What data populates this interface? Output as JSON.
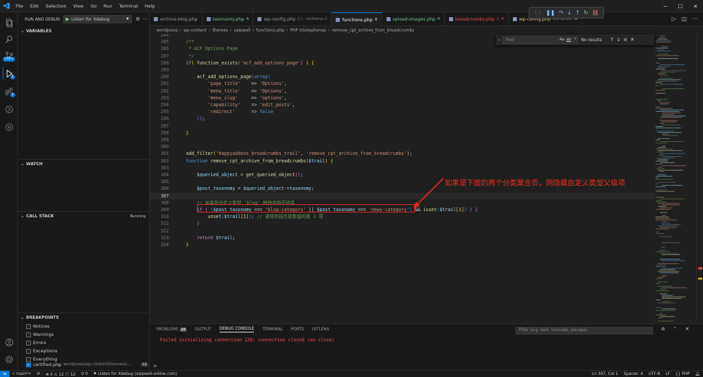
{
  "titlebar": {
    "menu": [
      "File",
      "Edit",
      "Selection",
      "View",
      "Go",
      "Run",
      "Terminal",
      "Help"
    ]
  },
  "debug_toolbar": [
    "pause-icon",
    "restart-icon",
    "step-over-icon",
    "step-into-icon",
    "step-out-icon",
    "restart-icon",
    "disconnect-icon"
  ],
  "sidebar": {
    "header": "RUN AND DEBUG",
    "config": "Listen for Xdebug",
    "sections": {
      "variables": "VARIABLES",
      "watch": "WATCH",
      "call_stack": "CALL STACK",
      "call_stack_status": "Running",
      "breakpoints": "BREAKPOINTS"
    },
    "breakpoints": [
      {
        "label": "Notices",
        "checked": false
      },
      {
        "label": "Warnings",
        "checked": false
      },
      {
        "label": "Errors",
        "checked": false
      },
      {
        "label": "Exceptions",
        "checked": false
      },
      {
        "label": "Everything",
        "checked": false
      }
    ],
    "bp_file": {
      "name": "certified.php",
      "path": "wordpress\\wp-content\\themes\\s...",
      "line": "56"
    }
  },
  "activity_badges": {
    "search": "10K+",
    "debug": "1",
    "extensions": "1"
  },
  "tabs": [
    {
      "label": "archive-blog.php",
      "sub": "",
      "mark": "",
      "color": "#9d9d9d"
    },
    {
      "label": "taxonomy.php",
      "sub": "",
      "mark": "A",
      "color": "#73c991"
    },
    {
      "label": "wp-config.php",
      "sub": "C:\\...\\fs3temp-3",
      "mark": "",
      "color": "#9d9d9d"
    },
    {
      "label": "functions.php",
      "sub": "",
      "mark": "X",
      "color": "#ffffff"
    },
    {
      "label": "upload-images.php",
      "sub": "",
      "mark": "A",
      "color": "#73c991"
    },
    {
      "label": "breadcrumbs.php",
      "sub": "",
      "mark": "1, A",
      "color": "#f14c4c"
    },
    {
      "label": "wp-config.php",
      "sub": "wordpress",
      "mark": "M",
      "color": "#e2c08d"
    }
  ],
  "breadcrumbs": [
    "wordpress",
    "wp-content",
    "themes",
    "saipwell",
    "functions.php",
    "PHP Intelephense",
    "remove_cpt_archive_from_breadcrumbs"
  ],
  "find": {
    "placeholder": "Find",
    "opt_case": "Aa",
    "opt_word": "ab",
    "opt_regex": ".*",
    "result": "No results"
  },
  "code_lines": [
    {
      "n": "284",
      "segs": []
    },
    {
      "n": "285",
      "segs": [
        [
          "c-com",
          "    /**"
        ]
      ]
    },
    {
      "n": "286",
      "segs": [
        [
          "c-com",
          "     * ACF Options Page"
        ]
      ]
    },
    {
      "n": "287",
      "segs": [
        [
          "c-com",
          "     */"
        ]
      ]
    },
    {
      "n": "288",
      "segs": [
        [
          "c-ctl",
          "    if"
        ],
        [
          "c-br1",
          "("
        ],
        [
          "c-pun",
          " "
        ],
        [
          "c-fn",
          "function_exists"
        ],
        [
          "c-br2",
          "("
        ],
        [
          "c-str",
          "'acf_add_options_page'"
        ],
        [
          "c-br2",
          ")"
        ],
        [
          "c-pun",
          " "
        ],
        [
          "c-br1",
          ")"
        ],
        [
          "c-pun",
          " "
        ],
        [
          "c-br1",
          "{"
        ]
      ]
    },
    {
      "n": "289",
      "segs": []
    },
    {
      "n": "290",
      "segs": [
        [
          "c-fn",
          "        acf_add_options_page"
        ],
        [
          "c-br2",
          "("
        ],
        [
          "c-kw",
          "array"
        ],
        [
          "c-br3",
          "("
        ]
      ]
    },
    {
      "n": "291",
      "segs": [
        [
          "c-str",
          "            'page_title'"
        ],
        [
          "c-pun",
          "    => "
        ],
        [
          "c-str",
          "'Options'"
        ],
        [
          "c-pun",
          ","
        ]
      ]
    },
    {
      "n": "292",
      "segs": [
        [
          "c-str",
          "            'menu_title'"
        ],
        [
          "c-pun",
          "    => "
        ],
        [
          "c-str",
          "'Options'"
        ],
        [
          "c-pun",
          ","
        ]
      ]
    },
    {
      "n": "293",
      "segs": [
        [
          "c-str",
          "            'menu_slug'"
        ],
        [
          "c-pun",
          "     => "
        ],
        [
          "c-str",
          "'options'"
        ],
        [
          "c-pun",
          ","
        ]
      ]
    },
    {
      "n": "294",
      "segs": [
        [
          "c-str",
          "            'capability'"
        ],
        [
          "c-pun",
          "    => "
        ],
        [
          "c-str",
          "'edit_posts'"
        ],
        [
          "c-pun",
          ","
        ]
      ]
    },
    {
      "n": "295",
      "segs": [
        [
          "c-str",
          "            'redirect'"
        ],
        [
          "c-pun",
          "      => "
        ],
        [
          "c-kw",
          "false"
        ]
      ]
    },
    {
      "n": "296",
      "segs": [
        [
          "c-br3",
          "        )"
        ],
        [
          "c-br2",
          ")"
        ],
        [
          "c-pun",
          ";"
        ]
      ]
    },
    {
      "n": "297",
      "segs": []
    },
    {
      "n": "298",
      "segs": [
        [
          "c-br1",
          "    }"
        ]
      ]
    },
    {
      "n": "299",
      "segs": []
    },
    {
      "n": "300",
      "segs": []
    },
    {
      "n": "301",
      "segs": [
        [
          "c-fn",
          "    add_filter"
        ],
        [
          "c-br1",
          "("
        ],
        [
          "c-str",
          "'happyaddons_breadcrumbs_trail'"
        ],
        [
          "c-pun",
          ", "
        ],
        [
          "c-str",
          "'remove_cpt_archive_from_breadcrumbs'"
        ],
        [
          "c-br1",
          ")"
        ],
        [
          "c-pun",
          ";"
        ]
      ]
    },
    {
      "n": "302",
      "segs": [
        [
          "c-kw",
          "    function "
        ],
        [
          "c-fn",
          "remove_cpt_archive_from_breadcrumbs"
        ],
        [
          "c-br1",
          "("
        ],
        [
          "c-var",
          "$trail"
        ],
        [
          "c-br1",
          ")"
        ],
        [
          "c-pun",
          " "
        ],
        [
          "c-br1",
          "{"
        ]
      ]
    },
    {
      "n": "303",
      "segs": []
    },
    {
      "n": "304",
      "segs": [
        [
          "c-var",
          "        $queried_object"
        ],
        [
          "c-pun",
          " = "
        ],
        [
          "c-fn",
          "get_queried_object"
        ],
        [
          "c-br2",
          "()"
        ],
        [
          "c-pun",
          ";"
        ]
      ]
    },
    {
      "n": "305",
      "segs": []
    },
    {
      "n": "306",
      "segs": [
        [
          "c-var",
          "        $post_taxonomy"
        ],
        [
          "c-pun",
          " = "
        ],
        [
          "c-var",
          "$queried_object"
        ],
        [
          "c-pun",
          "->"
        ],
        [
          "c-var",
          "taxonomy"
        ],
        [
          "c-pun",
          ";"
        ]
      ]
    },
    {
      "n": "307",
      "segs": [],
      "current": true
    },
    {
      "n": "308",
      "segs": [
        [
          "c-com",
          "        // 如果是自定义类型 'blog' 移除存档页链接"
        ]
      ]
    },
    {
      "n": "309",
      "segs": [
        [
          "c-ctl",
          "        if"
        ],
        [
          "c-pun",
          " "
        ],
        [
          "c-br2",
          "("
        ],
        [
          "c-pun",
          " "
        ],
        [
          "c-br3",
          "("
        ],
        [
          "c-var",
          "$post_taxonomy"
        ],
        [
          "c-pun",
          " === "
        ],
        [
          "c-str",
          "'blog-category'"
        ],
        [
          "c-pun",
          " || "
        ],
        [
          "c-var",
          "$post_taxonomy"
        ],
        [
          "c-pun",
          " === "
        ],
        [
          "c-str",
          "'news-category'"
        ],
        [
          "c-br3",
          ")"
        ],
        [
          "c-pun",
          " && "
        ],
        [
          "c-fn",
          "isset"
        ],
        [
          "c-br3",
          "("
        ],
        [
          "c-var",
          "$trail"
        ],
        [
          "c-br1",
          "["
        ],
        [
          "c-pun",
          "1"
        ],
        [
          "c-br1",
          "]"
        ],
        [
          "c-br3",
          ")"
        ],
        [
          "c-pun",
          " "
        ],
        [
          "c-br2",
          ")"
        ],
        [
          "c-pun",
          " "
        ],
        [
          "c-br2",
          "{"
        ]
      ]
    },
    {
      "n": "310",
      "segs": [
        [
          "c-fn",
          "            unset"
        ],
        [
          "c-br3",
          "("
        ],
        [
          "c-var",
          "$trail"
        ],
        [
          "c-br1",
          "["
        ],
        [
          "c-pun",
          "1"
        ],
        [
          "c-br1",
          "]"
        ],
        [
          "c-br3",
          ")"
        ],
        [
          "c-pun",
          "; "
        ],
        [
          "c-com",
          "// 通常存档页是数组的第 1 项"
        ]
      ]
    },
    {
      "n": "311",
      "segs": [
        [
          "c-br2",
          "        }"
        ]
      ]
    },
    {
      "n": "312",
      "segs": []
    },
    {
      "n": "313",
      "segs": [
        [
          "c-ctl",
          "        return "
        ],
        [
          "c-var",
          "$trail"
        ],
        [
          "c-pun",
          ";"
        ]
      ]
    },
    {
      "n": "314",
      "segs": [
        [
          "c-br1",
          "    }"
        ]
      ]
    }
  ],
  "annotation": "如果是下面的两个分类聚合页，则隐藏自定义类型父级项",
  "panel": {
    "tabs": [
      "PROBLEMS",
      "OUTPUT",
      "DEBUG CONSOLE",
      "TERMINAL",
      "PORTS",
      "GITLENS"
    ],
    "problems_count": "24",
    "active_tab": "DEBUG CONSOLE",
    "filter_placeholder": "Filter (e.g. text, !exclude, \\escape)",
    "error": "Failed initializing connection 128: connection closed (on close)",
    "prompt": ">"
  },
  "statusbar": {
    "branch": "main*+",
    "errors": "0",
    "warnings_a": "12",
    "warnings_b": "12",
    "debug": "Listen for Xdebug (saipwell-online.com)",
    "position": "Ln 307, Col 1",
    "spaces": "Spaces: 4",
    "encoding": "UTF-8",
    "eol": "LF",
    "language": "PHP"
  }
}
